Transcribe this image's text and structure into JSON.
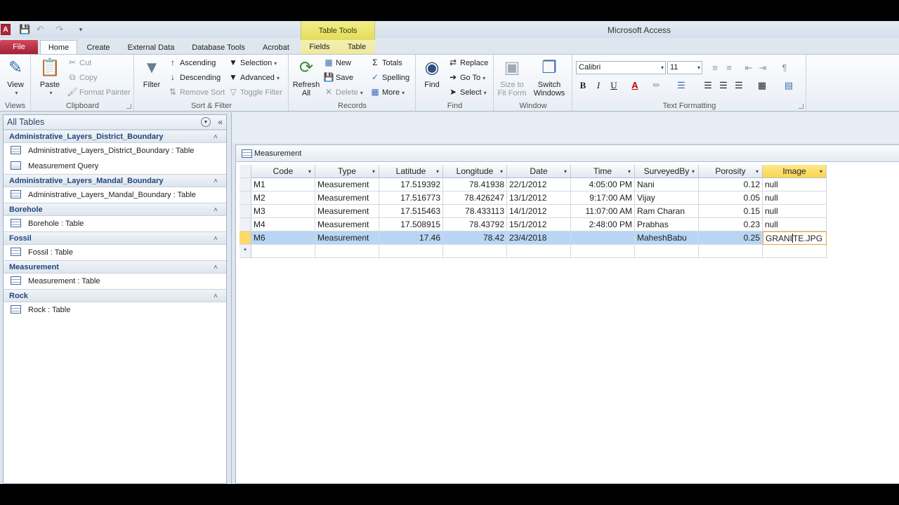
{
  "window": {
    "title": "Microsoft Access",
    "app_icon": "A"
  },
  "contextual": {
    "title": "Table Tools"
  },
  "tabs": {
    "file": "File",
    "home": "Home",
    "create": "Create",
    "external": "External Data",
    "dbtools": "Database Tools",
    "acrobat": "Acrobat",
    "fields": "Fields",
    "table": "Table"
  },
  "ribbon": {
    "views": {
      "view": "View",
      "label": "Views"
    },
    "clipboard": {
      "paste": "Paste",
      "cut": "Cut",
      "copy": "Copy",
      "format_painter": "Format Painter",
      "label": "Clipboard"
    },
    "sortfilter": {
      "filter": "Filter",
      "ascending": "Ascending",
      "descending": "Descending",
      "remove_sort": "Remove Sort",
      "selection": "Selection",
      "advanced": "Advanced",
      "toggle_filter": "Toggle Filter",
      "label": "Sort & Filter"
    },
    "records": {
      "refresh_1": "Refresh",
      "refresh_2": "All",
      "new": "New",
      "save": "Save",
      "delete": "Delete",
      "totals": "Totals",
      "spelling": "Spelling",
      "more": "More",
      "label": "Records"
    },
    "find": {
      "find": "Find",
      "replace": "Replace",
      "goto": "Go To",
      "select": "Select",
      "label": "Find"
    },
    "window": {
      "size_1": "Size to",
      "size_2": "Fit Form",
      "switch_1": "Switch",
      "switch_2": "Windows",
      "label": "Window"
    },
    "text_formatting": {
      "font": "Calibri",
      "size": "11",
      "bold": "B",
      "italic": "I",
      "underline": "U",
      "font_color": "A",
      "label": "Text Formatting"
    }
  },
  "nav": {
    "header": "All Tables",
    "groups": [
      {
        "title": "Administrative_Layers_District_Boundary",
        "items": [
          "Administrative_Layers_District_Boundary : Table",
          "Measurement Query"
        ]
      },
      {
        "title": "Administrative_Layers_Mandal_Boundary",
        "items": [
          "Administrative_Layers_Mandal_Boundary : Table"
        ]
      },
      {
        "title": "Borehole",
        "items": [
          "Borehole : Table"
        ]
      },
      {
        "title": "Fossil",
        "items": [
          "Fossil : Table"
        ]
      },
      {
        "title": "Measurement",
        "items": [
          "Measurement : Table"
        ]
      },
      {
        "title": "Rock",
        "items": [
          "Rock : Table"
        ]
      }
    ]
  },
  "doc": {
    "tab_title": "Measurement",
    "columns": [
      "Code",
      "Type",
      "Latitude",
      "Longitude",
      "Date",
      "Time",
      "SurveyedBy",
      "Porosity",
      "Image"
    ],
    "rows": [
      [
        "M1",
        "Measurement",
        "17.519392",
        "78.41938",
        "22/1/2012",
        "4:05:00 PM",
        "Nani",
        "0.12",
        "null"
      ],
      [
        "M2",
        "Measurement",
        "17.516773",
        "78.426247",
        "13/1/2012",
        "9:17:00 AM",
        "Vijay",
        "0.05",
        "null"
      ],
      [
        "M3",
        "Measurement",
        "17.515463",
        "78.433113",
        "14/1/2012",
        "11:07:00 AM",
        "Ram Charan",
        "0.15",
        "null"
      ],
      [
        "M4",
        "Measurement",
        "17.508915",
        "78.43792",
        "15/1/2012",
        "2:48:00 PM",
        "Prabhas",
        "0.23",
        "null"
      ],
      [
        "M6",
        "Measurement",
        "17.46",
        "78.42",
        "23/4/2018",
        "",
        "MaheshBabu",
        "0.25",
        "GRANITE.JPG"
      ]
    ],
    "new_row_marker": "*"
  }
}
